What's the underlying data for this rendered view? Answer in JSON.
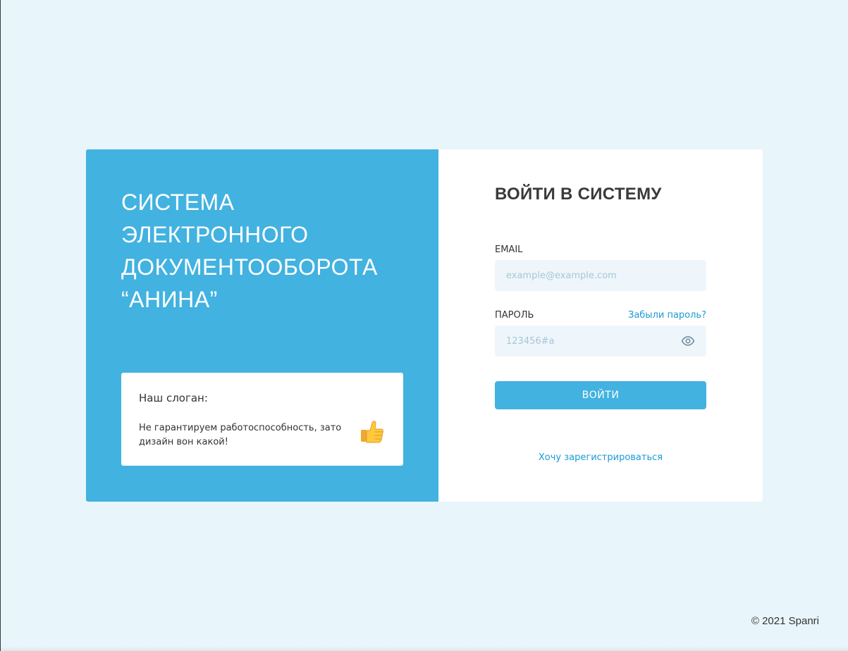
{
  "brand": {
    "title": "Система электронного документооборота “Анина”"
  },
  "slogan": {
    "title": "Наш слоган:",
    "text": "Не гарантируем работоспособность, зато дизайн вон какой!",
    "icon": "thumbs-up-icon"
  },
  "login": {
    "title": "ВОЙТИ В СИСТЕМУ",
    "email_label": "EMAIL",
    "email_placeholder": "example@example.com",
    "email_value": "",
    "password_label": "ПАРОЛЬ",
    "password_placeholder": "123456#a",
    "password_value": "",
    "forgot_link": "Забыли пароль?",
    "show_password_icon": "eye-icon",
    "submit_label": "ВОЙТИ",
    "register_link": "Хочу зарегистрироваться"
  },
  "footer": {
    "copyright": "© 2021 Spanri"
  },
  "colors": {
    "page_background": "#e8f5fb",
    "accent": "#42b2e0",
    "link": "#1a9cd1",
    "input_background": "#eef6fb",
    "heading_text": "#3a3a3a"
  }
}
